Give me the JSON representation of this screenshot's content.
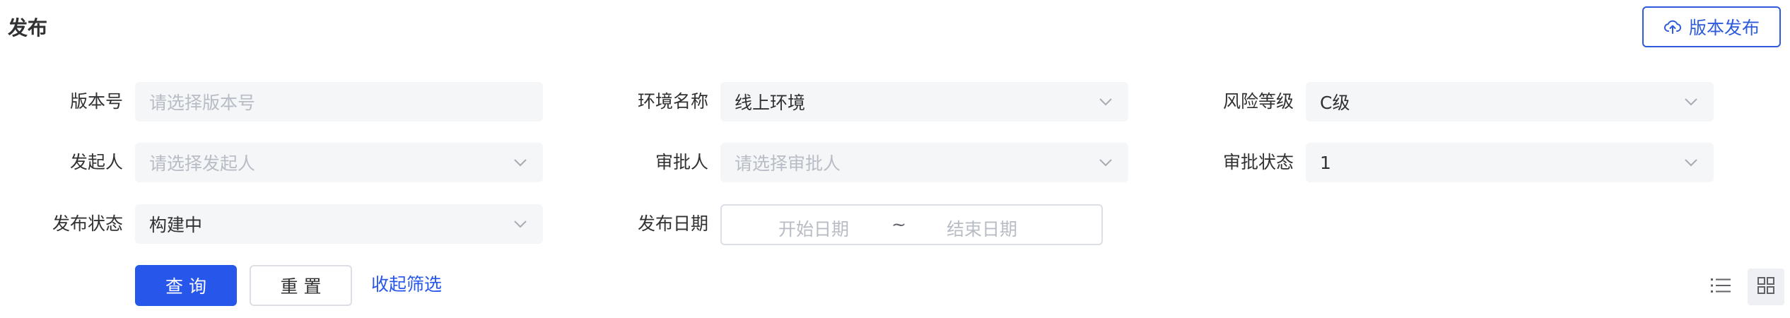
{
  "header": {
    "title": "发布",
    "publish_button_label": "版本发布",
    "publish_button_icon": "cloud-upload-icon",
    "accent_color": "#2656ea"
  },
  "filters": {
    "version": {
      "label": "版本号",
      "placeholder": "请选择版本号",
      "value": ""
    },
    "environment": {
      "label": "环境名称",
      "placeholder": "",
      "value": "线上环境"
    },
    "risk_level": {
      "label": "风险等级",
      "placeholder": "",
      "value": "C级"
    },
    "initiator": {
      "label": "发起人",
      "placeholder": "请选择发起人",
      "value": ""
    },
    "approver": {
      "label": "审批人",
      "placeholder": "请选择审批人",
      "value": ""
    },
    "approval_status": {
      "label": "审批状态",
      "placeholder": "",
      "value": "1"
    },
    "publish_status": {
      "label": "发布状态",
      "placeholder": "",
      "value": "构建中"
    },
    "publish_date": {
      "label": "发布日期",
      "start_placeholder": "开始日期",
      "separator": "~",
      "end_placeholder": "结束日期"
    }
  },
  "actions": {
    "query_label": "查询",
    "reset_label": "重置",
    "collapse_label": "收起筛选"
  },
  "view_toggle": {
    "list_icon": "list-view-icon",
    "grid_icon": "grid-view-icon",
    "active": "grid"
  }
}
